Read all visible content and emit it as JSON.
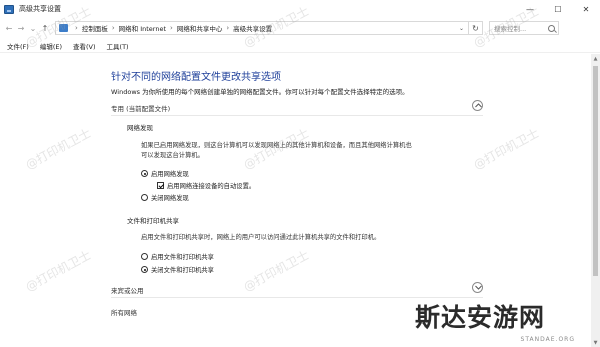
{
  "window": {
    "title": "高级共享设置",
    "controls": {
      "minimize": "—",
      "maximize": "☐",
      "close": "✕"
    }
  },
  "address_bar": {
    "crumbs": [
      "控制面板",
      "网络和 Internet",
      "网络和共享中心",
      "高级共享设置"
    ],
    "search_placeholder": "搜索控制..."
  },
  "menu": [
    "文件(F)",
    "编辑(E)",
    "查看(V)",
    "工具(T)"
  ],
  "page": {
    "title": "针对不同的网络配置文件更改共享选项",
    "description": "Windows 为你所使用的每个网络创建单独的网络配置文件。你可以针对每个配置文件选择特定的选项。"
  },
  "profile_private": {
    "header": "专用 (当前配置文件)",
    "network_discovery": {
      "title": "网络发现",
      "text_line1": "如果已启用网络发现，则这台计算机可以发现网络上的其他计算机和设备，而且其他网络计算机也",
      "text_line2": "可以发现这台计算机。",
      "enable_label": "启用网络发现",
      "auto_setup_label": "启用网络连接设备的自动设置。",
      "disable_label": "关闭网络发现",
      "enabled": true,
      "auto_setup": true
    },
    "file_printer_sharing": {
      "title": "文件和打印机共享",
      "text": "启用文件和打印机共享时，网络上的用户可以访问通过此计算机共享的文件和打印机。",
      "enable_label": "启用文件和打印机共享",
      "disable_label": "关闭文件和打印机共享",
      "enabled": false
    }
  },
  "profile_guest": {
    "header": "来宾或公用"
  },
  "profile_all": {
    "header": "所有网络"
  },
  "watermark": "@打印机卫士",
  "logo": {
    "cn": "斯达安游网",
    "en": "STANDAE.ORG"
  }
}
